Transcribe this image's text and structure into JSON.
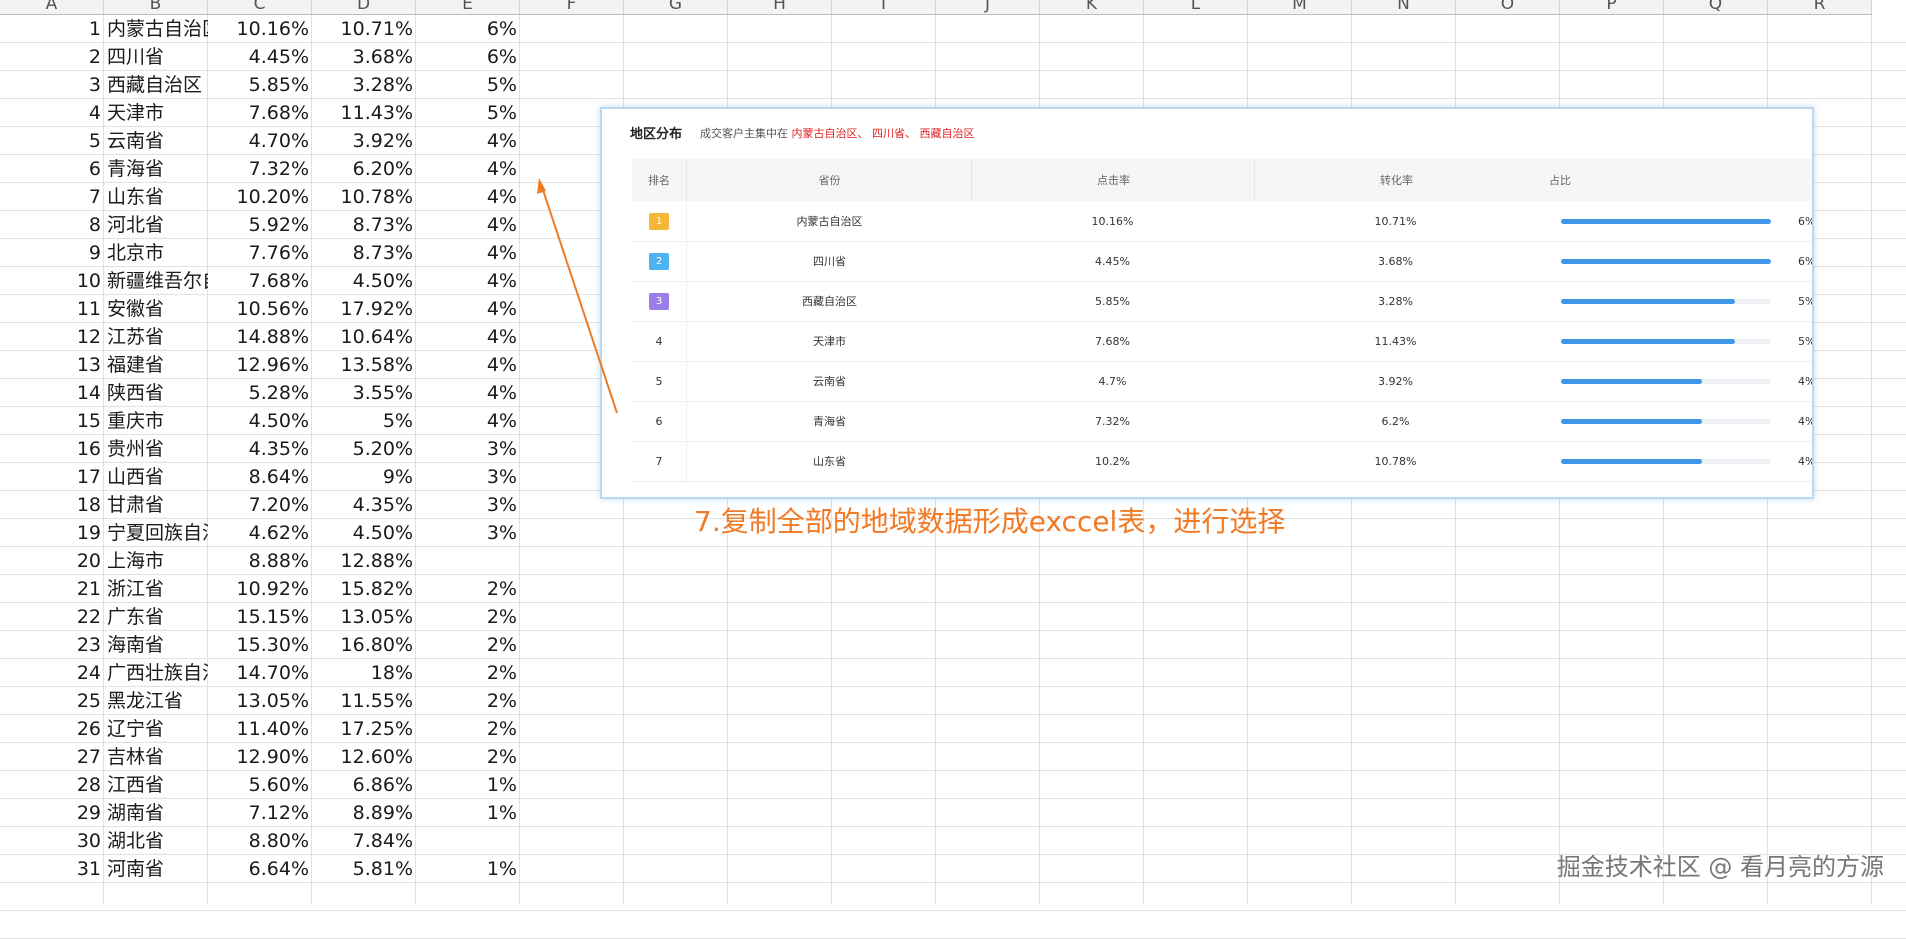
{
  "columns": [
    "A",
    "B",
    "C",
    "D",
    "E",
    "F",
    "G",
    "H",
    "I",
    "J",
    "K",
    "L",
    "M",
    "N",
    "O",
    "P",
    "Q",
    "R"
  ],
  "rows": [
    [
      "1",
      "内蒙古自治区",
      "10.16%",
      "10.71%",
      "6%"
    ],
    [
      "2",
      "四川省",
      "4.45%",
      "3.68%",
      "6%"
    ],
    [
      "3",
      "西藏自治区",
      "5.85%",
      "3.28%",
      "5%"
    ],
    [
      "4",
      "天津市",
      "7.68%",
      "11.43%",
      "5%"
    ],
    [
      "5",
      "云南省",
      "4.70%",
      "3.92%",
      "4%"
    ],
    [
      "6",
      "青海省",
      "7.32%",
      "6.20%",
      "4%"
    ],
    [
      "7",
      "山东省",
      "10.20%",
      "10.78%",
      "4%"
    ],
    [
      "8",
      "河北省",
      "5.92%",
      "8.73%",
      "4%"
    ],
    [
      "9",
      "北京市",
      "7.76%",
      "8.73%",
      "4%"
    ],
    [
      "10",
      "新疆维吾尔自治区",
      "7.68%",
      "4.50%",
      "4%"
    ],
    [
      "11",
      "安徽省",
      "10.56%",
      "17.92%",
      "4%"
    ],
    [
      "12",
      "江苏省",
      "14.88%",
      "10.64%",
      "4%"
    ],
    [
      "13",
      "福建省",
      "12.96%",
      "13.58%",
      "4%"
    ],
    [
      "14",
      "陕西省",
      "5.28%",
      "3.55%",
      "4%"
    ],
    [
      "15",
      "重庆市",
      "4.50%",
      "5%",
      "4%"
    ],
    [
      "16",
      "贵州省",
      "4.35%",
      "5.20%",
      "3%"
    ],
    [
      "17",
      "山西省",
      "8.64%",
      "9%",
      "3%"
    ],
    [
      "18",
      "甘肃省",
      "7.20%",
      "4.35%",
      "3%"
    ],
    [
      "19",
      "宁夏回族自治区",
      "4.62%",
      "4.50%",
      "3%"
    ],
    [
      "20",
      "上海市",
      "8.88%",
      "12.88%",
      ""
    ],
    [
      "21",
      "浙江省",
      "10.92%",
      "15.82%",
      "2%"
    ],
    [
      "22",
      "广东省",
      "15.15%",
      "13.05%",
      "2%"
    ],
    [
      "23",
      "海南省",
      "15.30%",
      "16.80%",
      "2%"
    ],
    [
      "24",
      "广西壮族自治区",
      "14.70%",
      "18%",
      "2%"
    ],
    [
      "25",
      "黑龙江省",
      "13.05%",
      "11.55%",
      "2%"
    ],
    [
      "26",
      "辽宁省",
      "11.40%",
      "17.25%",
      "2%"
    ],
    [
      "27",
      "吉林省",
      "12.90%",
      "12.60%",
      "2%"
    ],
    [
      "28",
      "江西省",
      "5.60%",
      "6.86%",
      "1%"
    ],
    [
      "29",
      "湖南省",
      "7.12%",
      "8.89%",
      "1%"
    ],
    [
      "30",
      "湖北省",
      "8.80%",
      "7.84%",
      ""
    ],
    [
      "31",
      "河南省",
      "6.64%",
      "5.81%",
      "1%"
    ]
  ],
  "panel": {
    "title": "地区分布",
    "subtitle_prefix": "成交客户主集中在",
    "subtitle_highlight": "内蒙古自治区、 四川省、 西藏自治区",
    "headers": {
      "rank": "排名",
      "province": "省份",
      "click": "点击率",
      "conversion": "转化率",
      "share": "占比"
    },
    "rows": [
      {
        "rank": "1",
        "province": "内蒙古自治区",
        "click": "10.16%",
        "conversion": "10.71%",
        "share": "6%",
        "fill": 1.0
      },
      {
        "rank": "2",
        "province": "四川省",
        "click": "4.45%",
        "conversion": "3.68%",
        "share": "6%",
        "fill": 1.0
      },
      {
        "rank": "3",
        "province": "西藏自治区",
        "click": "5.85%",
        "conversion": "3.28%",
        "share": "5%",
        "fill": 0.83
      },
      {
        "rank": "4",
        "province": "天津市",
        "click": "7.68%",
        "conversion": "11.43%",
        "share": "5%",
        "fill": 0.83
      },
      {
        "rank": "5",
        "province": "云南省",
        "click": "4.7%",
        "conversion": "3.92%",
        "share": "4%",
        "fill": 0.67
      },
      {
        "rank": "6",
        "province": "青海省",
        "click": "7.32%",
        "conversion": "6.2%",
        "share": "4%",
        "fill": 0.67
      },
      {
        "rank": "7",
        "province": "山东省",
        "click": "10.2%",
        "conversion": "10.78%",
        "share": "4%",
        "fill": 0.67
      }
    ],
    "medal_colors": [
      "#f5b63a",
      "#4fb2f0",
      "#9b7fe6"
    ]
  },
  "annotation": "7.复制全部的地域数据形成exccel表，进行选择",
  "watermark": "掘金技术社区 @ 看月亮的方源",
  "colors": {
    "accent": "#f07a25",
    "bar": "#3f97ea",
    "highlight": "#e02020"
  }
}
